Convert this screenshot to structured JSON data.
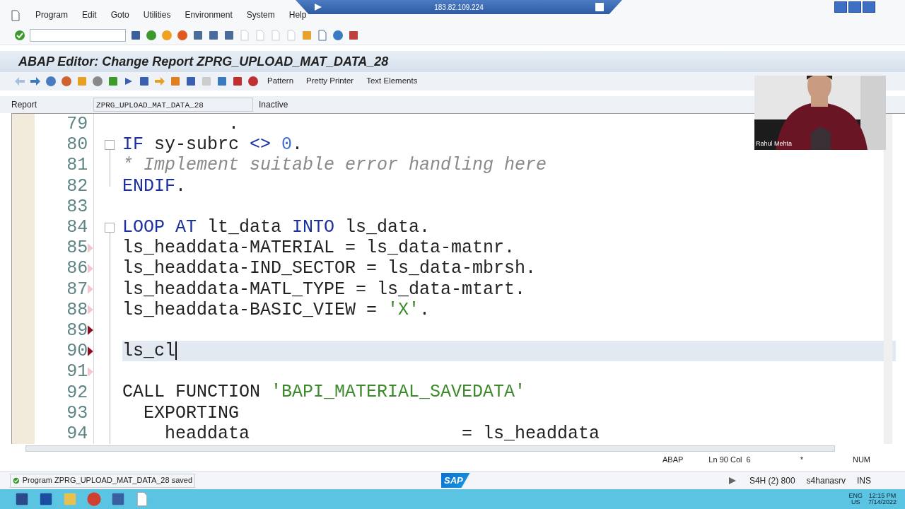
{
  "remote_bar": {
    "address": "183.82.109.224"
  },
  "menu": [
    "Program",
    "Edit",
    "Goto",
    "Utilities",
    "Environment",
    "System",
    "Help"
  ],
  "title": "ABAP Editor: Change Report ZPRG_UPLOAD_MAT_DATA_28",
  "app_toolbar": {
    "buttons": [
      "Pattern",
      "Pretty Printer",
      "Text Elements"
    ]
  },
  "report_row": {
    "label": "Report",
    "value": "ZPRG_UPLOAD_MAT_DATA_28",
    "status": "Inactive"
  },
  "editor": {
    "lines": [
      {
        "number": "79",
        "current": false,
        "tokens": [
          {
            "kind": "plain",
            "text": "          ."
          }
        ]
      },
      {
        "number": "80",
        "current": false,
        "tokens": [
          {
            "kind": "keyword",
            "text": "IF"
          },
          {
            "kind": "plain",
            "text": " sy-subrc "
          },
          {
            "kind": "keyword",
            "text": "<>"
          },
          {
            "kind": "number",
            "text": " 0"
          },
          {
            "kind": "plain",
            "text": "."
          }
        ],
        "children": [
          {
            "number": "81",
            "current": false,
            "tokens": [
              {
                "kind": "comment",
                "text": "* Implement suitable error handling here"
              }
            ]
          },
          {
            "number": "82",
            "current": false,
            "tokens": [
              {
                "kind": "keyword",
                "text": "ENDIF"
              },
              {
                "kind": "plain",
                "text": "."
              }
            ]
          }
        ]
      },
      {
        "number": "83",
        "current": false
      },
      {
        "number": "84",
        "current": false,
        "tokens": [
          {
            "kind": "keyword",
            "text": "LOOP AT"
          },
          {
            "kind": "plain",
            "text": " lt_data "
          },
          {
            "kind": "keyword",
            "text": "INTO"
          },
          {
            "kind": "plain",
            "text": " ls_data."
          }
        ],
        "children": [
          {
            "number": "85",
            "current": false,
            "color": "#f2c6cc",
            "tokens": [
              {
                "kind": "plain",
                "text": "ls_headdata-MATERIAL = ls_data-matnr."
              }
            ]
          },
          {
            "number": "86",
            "current": false,
            "color": "#f2c6cc",
            "tokens": [
              {
                "kind": "plain",
                "text": "ls_headdata-IND_SECTOR = ls_data-mbrsh."
              }
            ]
          },
          {
            "number": "87",
            "current": false,
            "color": "#f2c6cc",
            "tokens": [
              {
                "kind": "plain",
                "text": "ls_headdata-MATL_TYPE = ls_data-mtart."
              }
            ]
          },
          {
            "number": "88",
            "current": false,
            "color": "#f2c6cc",
            "tokens": [
              {
                "kind": "plain",
                "text": "ls_headdata-BASIC_VIEW = "
              },
              {
                "kind": "string",
                "text": "'X'"
              },
              {
                "kind": "plain",
                "text": "."
              }
            ]
          },
          {
            "number": "89",
            "current": false,
            "color": "#8c1020"
          },
          {
            "number": "90",
            "current": true,
            "color": "#8c1020",
            "tokens": [
              {
                "kind": "plain",
                "text": "ls_cl"
              }
            ]
          },
          {
            "number": "91",
            "current": false,
            "color": "#f2c6cc"
          },
          {
            "number": "92",
            "current": false,
            "tokens": [
              {
                "kind": "plain",
                "text": "CALL FUNCTION "
              },
              {
                "kind": "string",
                "text": "'BAPI_MATERIAL_SAVEDATA'"
              }
            ]
          },
          {
            "number": "93",
            "current": false,
            "tokens": [
              {
                "kind": "plain",
                "text": "  EXPORTING"
              }
            ]
          },
          {
            "number": "94",
            "current": false,
            "tokens": [
              {
                "kind": "plain",
                "text": "    headdata                    = ls_headdata"
              }
            ]
          }
        ]
      }
    ]
  },
  "webcam": {
    "kind": "picture",
    "name_label": "Rahul Mehta"
  },
  "info_row": {
    "mode": "ABAP",
    "position": "Ln 90 Col  6",
    "modified": "*",
    "num_lock": "NUM"
  },
  "status_bar": {
    "message": "Program ZPRG_UPLOAD_MAT_DATA_28 saved",
    "logo": "SAP",
    "system": "S4H (2) 800",
    "server": "s4hanasrv",
    "input_mode": "INS"
  },
  "taskbar": {
    "language": "ENG",
    "region": "US",
    "time": "12:15 PM",
    "date": "7/14/2022"
  }
}
